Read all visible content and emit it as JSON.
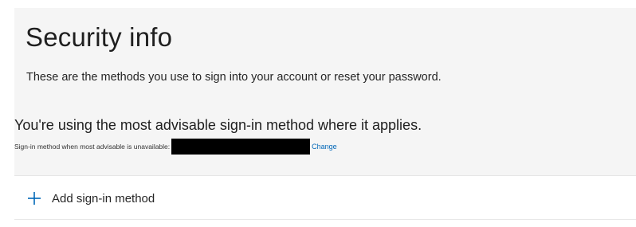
{
  "page": {
    "title": "Security info",
    "subtitle": "These are the methods you use to sign into your account or reset your password."
  },
  "default_method": {
    "notice": "You're using the most advisable sign-in method where it applies.",
    "fallback_label": "Sign-in method when most advisable is unavailable:",
    "change_link": "Change"
  },
  "methods": {
    "add_label": "Add sign-in method",
    "add_icon": "plus-icon"
  },
  "colors": {
    "link": "#0067b8",
    "plus_icon": "#0067b8",
    "background": "#f5f5f5",
    "card": "#ffffff"
  }
}
